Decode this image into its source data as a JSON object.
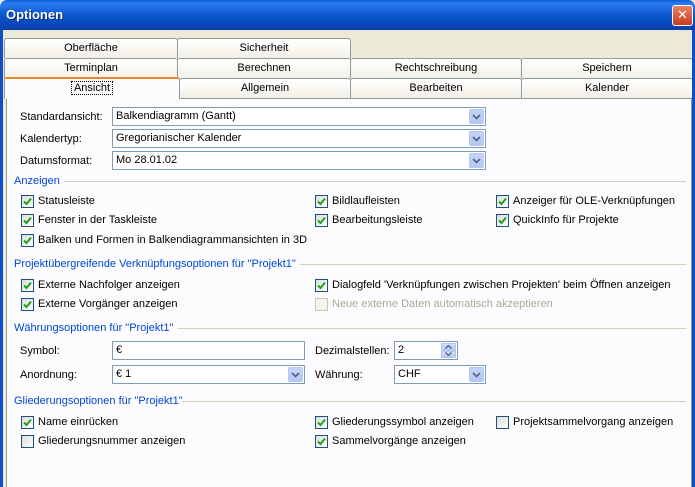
{
  "window": {
    "title": "Optionen",
    "close_glyph": "✕"
  },
  "tabs": {
    "row1": [
      "Oberfläche",
      "Sicherheit"
    ],
    "row2": [
      "Terminplan",
      "Berechnen",
      "Rechtschreibung",
      "Speichern"
    ],
    "row3": [
      "Ansicht",
      "Allgemein",
      "Bearbeiten",
      "Kalender"
    ],
    "active": "Ansicht"
  },
  "fields": {
    "standardansicht": {
      "label": "Standardansicht:",
      "value": "Balkendiagramm (Gantt)"
    },
    "kalendertyp": {
      "label": "Kalendertyp:",
      "value": "Gregorianischer Kalender"
    },
    "datumsformat": {
      "label": "Datumsformat:",
      "value": "Mo 28.01.02"
    }
  },
  "anzeigen": {
    "title": "Anzeigen",
    "items": [
      {
        "label": "Statusleiste",
        "checked": true
      },
      {
        "label": "Bildlaufleisten",
        "checked": true
      },
      {
        "label": "Anzeiger für OLE-Verknüpfungen",
        "checked": true
      },
      {
        "label": "Fenster in der Taskleiste",
        "checked": true
      },
      {
        "label": "Bearbeitungsleiste",
        "checked": true
      },
      {
        "label": "QuickInfo für Projekte",
        "checked": true
      },
      {
        "label": "Balken und Formen in Balkendiagrammansichten in 3D",
        "checked": true
      }
    ]
  },
  "verknuepfung": {
    "title": "Projektübergreifende Verknüpfungsoptionen für \"Projekt1\"",
    "items": [
      {
        "label": "Externe Nachfolger anzeigen",
        "checked": true
      },
      {
        "label": "Dialogfeld 'Verknüpfungen zwischen Projekten' beim Öffnen anzeigen",
        "checked": true
      },
      {
        "label": "Externe Vorgänger anzeigen",
        "checked": true
      },
      {
        "label": "Neue externe Daten automatisch akzeptieren",
        "checked": false,
        "disabled": true
      }
    ]
  },
  "waehrung": {
    "title": "Währungsoptionen für \"Projekt1\"",
    "symbol": {
      "label": "Symbol:",
      "value": "€"
    },
    "dezimalstellen": {
      "label": "Dezimalstellen:",
      "value": "2"
    },
    "anordnung": {
      "label": "Anordnung:",
      "value": "€ 1"
    },
    "waehrung": {
      "label": "Währung:",
      "value": "CHF"
    }
  },
  "gliederung": {
    "title": "Gliederungsoptionen für \"Projekt1\"",
    "items": [
      {
        "label": "Name einrücken",
        "checked": true
      },
      {
        "label": "Gliederungssymbol anzeigen",
        "checked": true
      },
      {
        "label": "Projektsammelvorgang anzeigen",
        "checked": false
      },
      {
        "label": "Gliederungsnummer anzeigen",
        "checked": false
      },
      {
        "label": "Sammelvorgänge anzeigen",
        "checked": true
      }
    ]
  },
  "colors": {
    "accent": "#0046d5",
    "titlebar": "#0b57d0",
    "active_tab": "#e68b2c",
    "check": "#21a121"
  }
}
